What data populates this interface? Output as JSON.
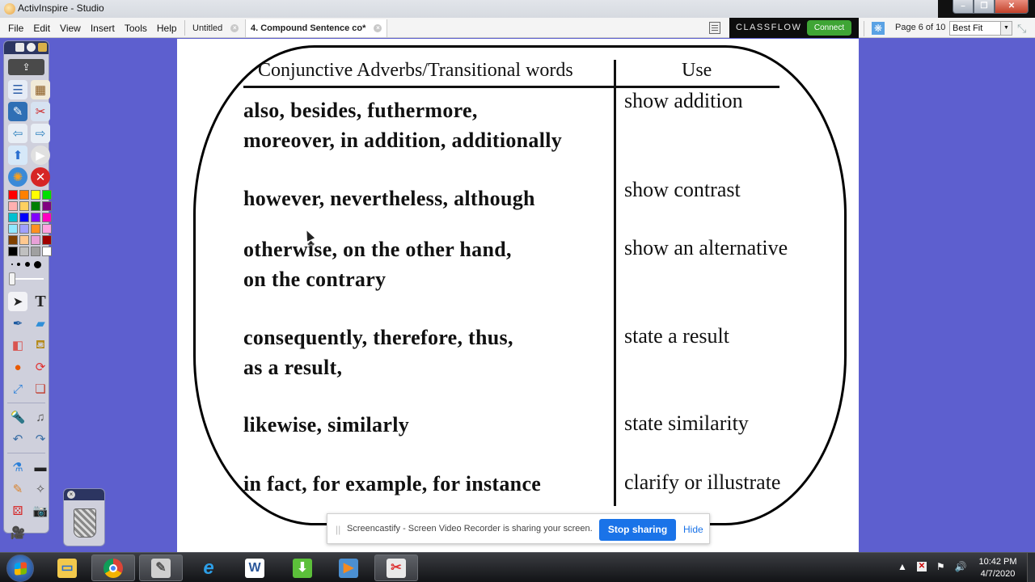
{
  "window": {
    "title": "ActivInspire - Studio",
    "controls": {
      "minimize": "–",
      "restore": "❐",
      "close": "✕"
    }
  },
  "menu": [
    "File",
    "Edit",
    "View",
    "Insert",
    "Tools",
    "Help"
  ],
  "tabs": [
    {
      "label": "Untitled",
      "active": false
    },
    {
      "label": "4. Compound Sentence co*",
      "active": true
    }
  ],
  "toolbar": {
    "classflow_brand": "CLASSFLOW",
    "classflow_connect": "Connect",
    "page_indicator": "Page 6 of 10",
    "zoom_value": "Best Fit"
  },
  "toolbox": {
    "palette": [
      "#ff0000",
      "#ff8000",
      "#ffff00",
      "#00e000",
      "#ffb0b0",
      "#ffd060",
      "#008000",
      "#800080",
      "#00c0d0",
      "#0000ff",
      "#8000ff",
      "#ff00c0",
      "#90e8ff",
      "#a0a0ff",
      "#ff9020",
      "#ffa0e0",
      "#804000",
      "#ffc890",
      "#e8a0d8",
      "#a00000",
      "#000000",
      "#c0c0c0",
      "#a0a0a0",
      "#ffffff"
    ],
    "tools": [
      "select-icon",
      "text-icon",
      "pen-icon",
      "highlighter-icon",
      "eraser-icon",
      "fill-icon",
      "shape-icon",
      "revert-icon",
      "connector-icon",
      "resource-library-icon",
      "spotlight-icon",
      "media-icon",
      "undo-icon",
      "redo-icon",
      "clear-icon",
      "reveal-icon",
      "magic-ink-icon",
      "camera-snapshot-icon",
      "dice-icon",
      "camera-icon",
      "recorder-icon"
    ]
  },
  "flipchart": {
    "header_words": "Conjunctive Adverbs/Transitional words",
    "header_use": "Use",
    "rows": [
      {
        "words": [
          "also,  besides,  futhermore,",
          "moreover,  in addition, additionally"
        ],
        "use": "show addition"
      },
      {
        "words": [
          "however,  nevertheless, although"
        ],
        "use": "show contrast"
      },
      {
        "words": [
          "otherwise,  on the other hand,",
          "on the contrary"
        ],
        "use": "show an alternative"
      },
      {
        "words": [
          "consequently,  therefore,  thus,",
          "as a result,"
        ],
        "use": "state a result"
      },
      {
        "words": [
          "likewise,  similarly"
        ],
        "use": "state similarity"
      },
      {
        "words": [
          "in fact,  for example,  for instance"
        ],
        "use": "clarify or illustrate"
      }
    ]
  },
  "share_bar": {
    "message": "Screencastify - Screen Video Recorder is sharing your screen.",
    "stop_label": "Stop sharing",
    "hide_label": "Hide"
  },
  "taskbar": {
    "time": "10:42 PM",
    "date": "4/7/2020"
  },
  "colors": {
    "desktop_bg": "#5d5fcf",
    "classflow_green": "#3fa535",
    "share_blue": "#1a73e8"
  }
}
